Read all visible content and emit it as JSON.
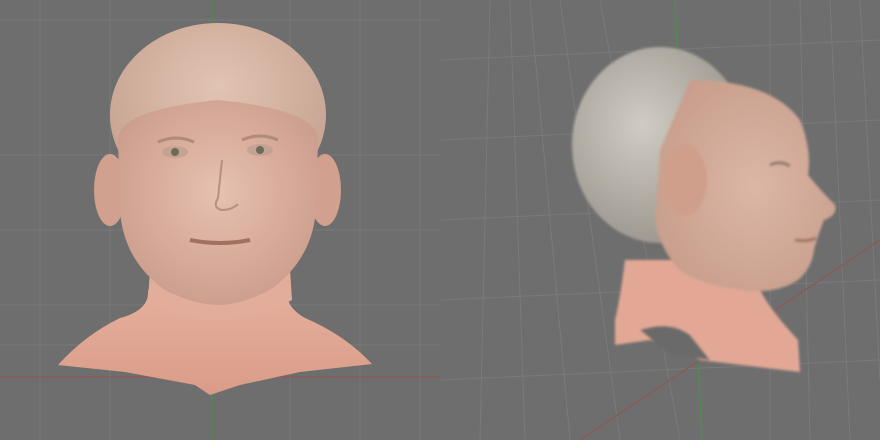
{
  "colors": {
    "viewport_bg": "#6e6e6e",
    "grid_line": "#787878",
    "axis_green": "#4f8a4f",
    "axis_red": "#8a5a5a",
    "skin": "#e3b3a0",
    "skin_face": "#d9b2a3",
    "hair_gray": "#b9b4ab",
    "neck_pink": "#e8a994"
  },
  "viewports": [
    {
      "view": "front",
      "model": "head-scan",
      "icon": "head-front-model"
    },
    {
      "view": "side",
      "model": "head-scan",
      "icon": "head-side-model"
    }
  ]
}
